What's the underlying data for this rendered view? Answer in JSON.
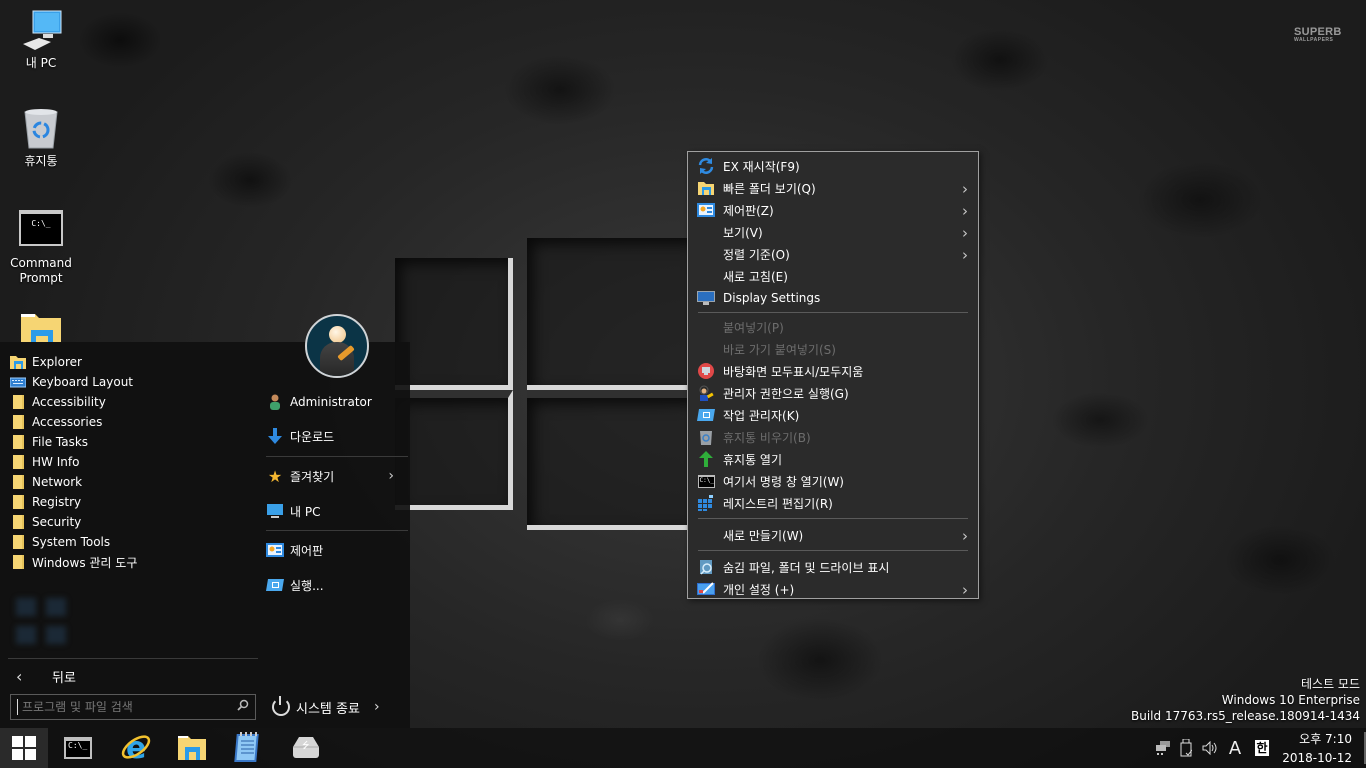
{
  "wallpaper": {
    "watermark_line1": "SUPERB",
    "watermark_line2": "WALLPAPERS"
  },
  "desktop_icons": [
    {
      "label": "내 PC",
      "icon": "computer-icon"
    },
    {
      "label": "휴지통",
      "icon": "recycle-bin-icon"
    },
    {
      "label": "Command\nPrompt",
      "label_line1": "Command",
      "label_line2": "Prompt",
      "icon": "command-prompt-icon"
    },
    {
      "label": "",
      "icon": "file-explorer-icon"
    }
  ],
  "start_menu": {
    "programs": [
      {
        "label": "Explorer",
        "icon": "file-explorer-icon"
      },
      {
        "label": "Keyboard Layout",
        "icon": "keyboard-icon"
      },
      {
        "label": "Accessibility",
        "icon": "folder-icon"
      },
      {
        "label": "Accessories",
        "icon": "folder-icon"
      },
      {
        "label": "File Tasks",
        "icon": "folder-icon"
      },
      {
        "label": "HW Info",
        "icon": "folder-icon"
      },
      {
        "label": "Network",
        "icon": "folder-icon"
      },
      {
        "label": "Registry",
        "icon": "folder-icon"
      },
      {
        "label": "Security",
        "icon": "folder-icon"
      },
      {
        "label": "System Tools",
        "icon": "folder-icon"
      },
      {
        "label": "Windows 관리 도구",
        "icon": "folder-icon"
      }
    ],
    "back_label": "뒤로",
    "search_placeholder": "프로그램 및 파일 검색",
    "search_value": "",
    "right_links": [
      {
        "label": "Administrator",
        "icon": "user-icon"
      },
      {
        "label": "다운로드",
        "icon": "download-arrow-icon"
      },
      {
        "label": "즐겨찾기",
        "icon": "star-icon",
        "has_submenu": true
      },
      {
        "label": "내 PC",
        "icon": "computer-icon"
      },
      {
        "label": "제어판",
        "icon": "control-panel-icon"
      },
      {
        "label": "실행...",
        "icon": "run-icon"
      }
    ],
    "power_label": "시스템 종료"
  },
  "context_menu": {
    "items": [
      {
        "label": "EX 재시작(F9)",
        "icon": "refresh-icon",
        "enabled": true
      },
      {
        "label": "빠른 폴더 보기(Q)",
        "icon": "file-explorer-icon",
        "enabled": true,
        "has_submenu": true
      },
      {
        "label": "제어판(Z)",
        "icon": "control-panel-icon",
        "enabled": true,
        "has_submenu": true
      },
      {
        "label": "보기(V)",
        "icon": "",
        "enabled": true,
        "has_submenu": true
      },
      {
        "label": "정렬 기준(O)",
        "icon": "",
        "enabled": true,
        "has_submenu": true
      },
      {
        "label": "새로 고침(E)",
        "icon": "",
        "enabled": true
      },
      {
        "label": "Display Settings",
        "icon": "monitor-icon",
        "enabled": true
      },
      {
        "label": "붙여넣기(P)",
        "icon": "",
        "enabled": false
      },
      {
        "label": "바로 가기 붙여넣기(S)",
        "icon": "",
        "enabled": false
      },
      {
        "label": "바탕화면 모두표시/모두지움",
        "icon": "show-desktop-icon",
        "enabled": true
      },
      {
        "label": "관리자 권한으로 실행(G)",
        "icon": "admin-run-icon",
        "enabled": true
      },
      {
        "label": "작업 관리자(K)",
        "icon": "task-manager-icon",
        "enabled": true
      },
      {
        "label": "휴지통 비우기(B)",
        "icon": "recycle-bin-icon",
        "enabled": false
      },
      {
        "label": "휴지통 열기",
        "icon": "green-arrow-icon",
        "enabled": true
      },
      {
        "label": "여기서 명령 창 열기(W)",
        "icon": "command-prompt-icon",
        "enabled": true
      },
      {
        "label": "레지스트리 편집기(R)",
        "icon": "registry-icon",
        "enabled": true
      },
      {
        "label": "새로 만들기(W)",
        "icon": "",
        "enabled": true,
        "has_submenu": true
      },
      {
        "label": "숨김 파일, 폴더 및 드라이브 표시",
        "icon": "hidden-files-icon",
        "enabled": true
      },
      {
        "label": "개인 설정 (+)",
        "icon": "personalize-icon",
        "enabled": true,
        "has_submenu": true
      }
    ]
  },
  "desktop_watermark": {
    "line1": "테스트 모드",
    "line2": "Windows 10 Enterprise",
    "line3": "Build 17763.rs5_release.180914-1434"
  },
  "taskbar": {
    "apps": [
      {
        "name": "command-prompt",
        "icon": "command-prompt-icon"
      },
      {
        "name": "internet-explorer",
        "icon": "internet-explorer-icon"
      },
      {
        "name": "file-explorer",
        "icon": "file-explorer-icon"
      },
      {
        "name": "notepad",
        "icon": "notepad-icon"
      },
      {
        "name": "usb-drive",
        "icon": "usb-drive-icon"
      }
    ],
    "tray": {
      "ime_mode": "A",
      "ime_lang": "한"
    },
    "clock": {
      "time": "오후 7:10",
      "date": "2018-10-12"
    }
  }
}
